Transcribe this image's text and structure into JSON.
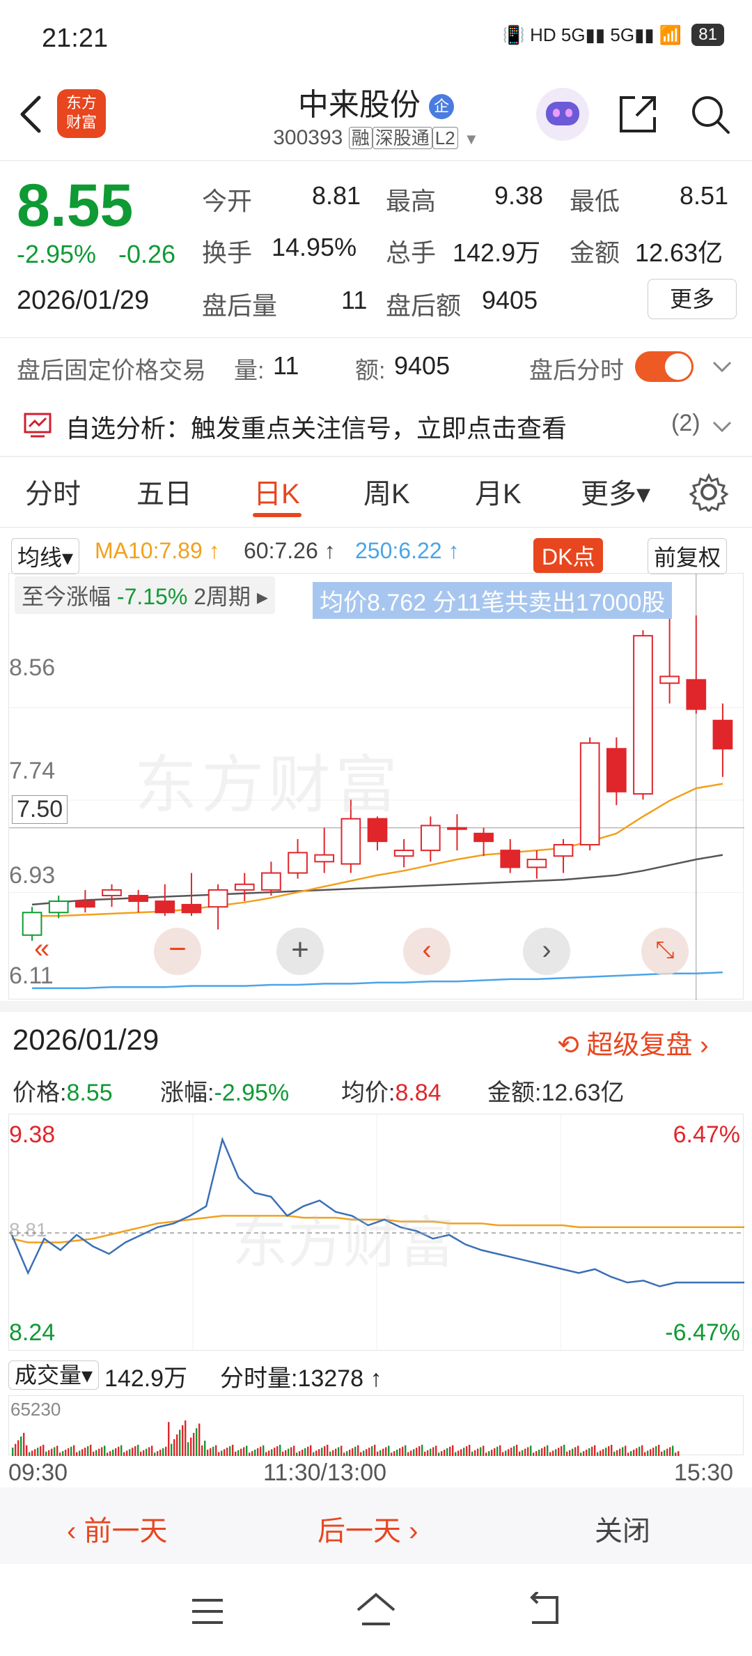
{
  "status_bar": {
    "time": "21:21",
    "icons": "📳 HD 5G▮▮ 5G▮▮ 📶",
    "battery": "81"
  },
  "header": {
    "logo_line1": "东方",
    "logo_line2": "财富",
    "title": "中来股份",
    "title_badge": "企",
    "code": "300393",
    "tags": [
      "融",
      "深股通",
      "L2"
    ]
  },
  "quote": {
    "price": "8.55",
    "change_pct": "-2.95%",
    "change": "-0.26",
    "date": "2026/01/29",
    "open_label": "今开",
    "open": "8.81",
    "high_label": "最高",
    "high": "9.38",
    "low_label": "最低",
    "low": "8.51",
    "turnover_label": "换手",
    "turnover": "14.95%",
    "volume_label": "总手",
    "volume": "142.9万",
    "amount_label": "金额",
    "amount": "12.63亿",
    "after_vol_label": "盘后量",
    "after_vol": "11",
    "after_amt_label": "盘后额",
    "after_amt": "9405",
    "more_button": "更多"
  },
  "after_hours": {
    "label": "盘后固定价格交易",
    "qty_label": "量:",
    "qty": "11",
    "amt_label": "额:",
    "amt": "9405",
    "toggle_label": "盘后分时"
  },
  "analysis": {
    "text": "自选分析：触发重点关注信号，立即点击查看",
    "count": "(2)"
  },
  "tabs": {
    "items": [
      "分时",
      "五日",
      "日K",
      "周K",
      "月K",
      "更多▾"
    ],
    "active": "日K"
  },
  "ma_row": {
    "selector": "均线▾",
    "ma10": "MA10:7.89 ↑",
    "ma60": "60:7.26 ↑",
    "ma250": "250:6.22 ↑",
    "dk": "DK点",
    "adjust": "前复权"
  },
  "kline": {
    "period_label": "至今涨幅",
    "period_value": "-7.15%",
    "period_span": "2周期 ▸",
    "tooltip": "均价8.762   分11笔共卖出17000股",
    "watermark": "东方财富",
    "y_labels": [
      "8.56",
      "7.74",
      "6.93",
      "6.11"
    ],
    "crosshair_price": "7.50"
  },
  "chart_data": [
    {
      "type": "candlestick",
      "title": "日K",
      "ylim": [
        6.11,
        9.38
      ],
      "candles": [
        {
          "o": 6.55,
          "c": 6.75,
          "h": 6.8,
          "l": 6.5
        },
        {
          "o": 6.75,
          "c": 6.85,
          "h": 6.9,
          "l": 6.7
        },
        {
          "o": 6.85,
          "c": 6.8,
          "h": 6.95,
          "l": 6.75
        },
        {
          "o": 6.9,
          "c": 6.95,
          "h": 7.0,
          "l": 6.8
        },
        {
          "o": 6.9,
          "c": 6.85,
          "h": 6.95,
          "l": 6.75
        },
        {
          "o": 6.85,
          "c": 6.75,
          "h": 7.0,
          "l": 6.72
        },
        {
          "o": 6.82,
          "c": 6.75,
          "h": 7.1,
          "l": 6.72
        },
        {
          "o": 6.8,
          "c": 6.95,
          "h": 7.0,
          "l": 6.6
        },
        {
          "o": 6.95,
          "c": 7.0,
          "h": 7.1,
          "l": 6.85
        },
        {
          "o": 6.95,
          "c": 7.1,
          "h": 7.2,
          "l": 6.9
        },
        {
          "o": 7.1,
          "c": 7.28,
          "h": 7.4,
          "l": 7.05
        },
        {
          "o": 7.2,
          "c": 7.26,
          "h": 7.5,
          "l": 7.1
        },
        {
          "o": 7.18,
          "c": 7.58,
          "h": 7.75,
          "l": 7.1
        },
        {
          "o": 7.58,
          "c": 7.38,
          "h": 7.6,
          "l": 7.3
        },
        {
          "o": 7.25,
          "c": 7.3,
          "h": 7.4,
          "l": 7.15
        },
        {
          "o": 7.3,
          "c": 7.52,
          "h": 7.6,
          "l": 7.2
        },
        {
          "o": 7.5,
          "c": 7.5,
          "h": 7.62,
          "l": 7.3
        },
        {
          "o": 7.45,
          "c": 7.38,
          "h": 7.5,
          "l": 7.25
        },
        {
          "o": 7.3,
          "c": 7.15,
          "h": 7.4,
          "l": 7.1
        },
        {
          "o": 7.15,
          "c": 7.22,
          "h": 7.3,
          "l": 7.05
        },
        {
          "o": 7.25,
          "c": 7.35,
          "h": 7.4,
          "l": 7.1
        },
        {
          "o": 7.35,
          "c": 8.25,
          "h": 8.3,
          "l": 7.3
        },
        {
          "o": 8.2,
          "c": 7.82,
          "h": 8.3,
          "l": 7.7
        },
        {
          "o": 7.8,
          "c": 9.2,
          "h": 9.25,
          "l": 7.75
        },
        {
          "o": 8.78,
          "c": 8.84,
          "h": 9.38,
          "l": 8.6
        },
        {
          "o": 8.81,
          "c": 8.55,
          "h": 9.38,
          "l": 8.51
        },
        {
          "o": 8.45,
          "c": 8.2,
          "h": 8.6,
          "l": 7.95
        }
      ],
      "ma10": [
        6.72,
        6.72,
        6.73,
        6.74,
        6.75,
        6.76,
        6.78,
        6.81,
        6.84,
        6.88,
        6.93,
        6.98,
        7.03,
        7.08,
        7.12,
        7.17,
        7.22,
        7.26,
        7.28,
        7.3,
        7.32,
        7.38,
        7.45,
        7.6,
        7.74,
        7.85,
        7.89
      ],
      "ma60": [
        6.82,
        6.84,
        6.86,
        6.87,
        6.88,
        6.89,
        6.9,
        6.91,
        6.92,
        6.93,
        6.94,
        6.95,
        6.96,
        6.97,
        6.98,
        6.99,
        7.0,
        7.01,
        7.02,
        7.03,
        7.04,
        7.06,
        7.08,
        7.12,
        7.17,
        7.22,
        7.26
      ],
      "ma250": [
        6.08,
        6.08,
        6.08,
        6.09,
        6.09,
        6.09,
        6.1,
        6.1,
        6.1,
        6.11,
        6.11,
        6.12,
        6.12,
        6.13,
        6.13,
        6.14,
        6.14,
        6.15,
        6.16,
        6.16,
        6.17,
        6.18,
        6.19,
        6.2,
        6.21,
        6.21,
        6.22
      ]
    },
    {
      "type": "line",
      "title": "分时",
      "ylim": [
        8.24,
        9.38
      ],
      "price": [
        8.8,
        8.6,
        8.78,
        8.72,
        8.8,
        8.74,
        8.7,
        8.76,
        8.8,
        8.84,
        8.86,
        8.9,
        8.95,
        9.3,
        9.1,
        9.02,
        9.0,
        8.9,
        8.95,
        8.98,
        8.92,
        8.9,
        8.85,
        8.88,
        8.84,
        8.82,
        8.78,
        8.8,
        8.75,
        8.72,
        8.7,
        8.68,
        8.66,
        8.64,
        8.62,
        8.6,
        8.62,
        8.58,
        8.55,
        8.56,
        8.53,
        8.55
      ],
      "avg": [
        8.78,
        8.76,
        8.76,
        8.76,
        8.77,
        8.78,
        8.8,
        8.82,
        8.84,
        8.86,
        8.87,
        8.88,
        8.89,
        8.9,
        8.9,
        8.9,
        8.9,
        8.9,
        8.89,
        8.89,
        8.89,
        8.88,
        8.88,
        8.88,
        8.87,
        8.87,
        8.87,
        8.86,
        8.86,
        8.86,
        8.85,
        8.85,
        8.85,
        8.85,
        8.85,
        8.84,
        8.84,
        8.84,
        8.84,
        8.84,
        8.84,
        8.84
      ]
    }
  ],
  "intraday": {
    "date": "2026/01/29",
    "review_label": "超级复盘",
    "price_label": "价格:",
    "price": "8.55",
    "change_label": "涨幅:",
    "change": "-2.95%",
    "avg_label": "均价:",
    "avg": "8.84",
    "amount_label": "金额:",
    "amount": "12.63亿",
    "y_top": "9.38",
    "y_bottom": "8.24",
    "y_mid": "8.81",
    "pct_top": "6.47%",
    "pct_bottom": "-6.47%",
    "volume_selector": "成交量▾",
    "volume_total": "142.9万",
    "minute_volume": "分时量:13278 ↑",
    "volume_max": "65230",
    "time_start": "09:30",
    "time_mid": "11:30/13:00",
    "time_end": "15:30"
  },
  "bottom_bar": {
    "prev": "前一天",
    "next": "后一天",
    "close": "关闭"
  }
}
